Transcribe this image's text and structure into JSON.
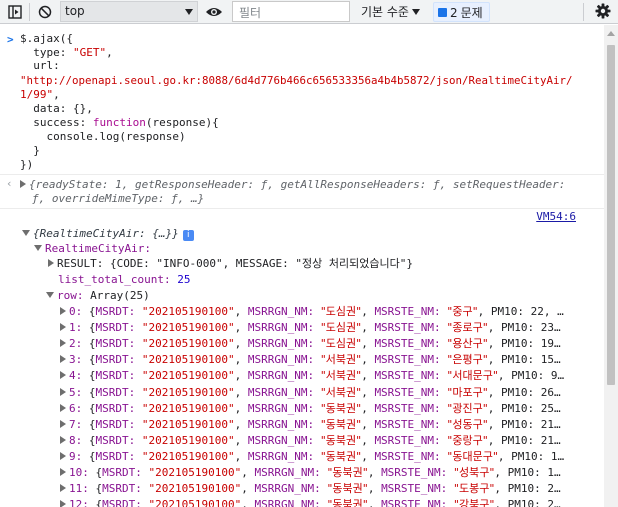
{
  "toolbar": {
    "context": "top",
    "filter_placeholder": "필터",
    "level": "기본 수준",
    "issues_count": "2",
    "issues_label": "문제"
  },
  "input": {
    "lines": [
      "$.ajax({",
      "  type: \"GET\",",
      "  url:",
      "\"http://openapi.seoul.go.kr:8088/6d4d776b466c656533356a4b4b5872/json/RealtimeCityAir/",
      "1/99\",",
      "  data: {},",
      "  success: function(response){",
      "    console.log(response)",
      "  }",
      "})"
    ]
  },
  "return_value": {
    "line1": "{readyState: 1, getResponseHeader: ƒ, getAllResponseHeaders: ƒ, setRequestHeader:",
    "line2": "ƒ, overrideMimeType: ƒ, …}"
  },
  "log": {
    "source": "VM54:6",
    "root": "{RealtimeCityAir: {…}}",
    "info": "i",
    "city_air": "RealtimeCityAir:",
    "result": "RESULT: {CODE: \"INFO-000\", MESSAGE: \"정상 처리되었습니다\"}",
    "list_total_count_key": "list_total_count:",
    "list_total_count": "25",
    "row_key": "row:",
    "row_type": "Array(25)",
    "rows": [
      {
        "i": "0",
        "date": "\"202105190100\"",
        "rgn": "\"도심권\"",
        "ste": "\"중구\"",
        "pm": "PM10: 22, …"
      },
      {
        "i": "1",
        "date": "\"202105190100\"",
        "rgn": "\"도심권\"",
        "ste": "\"종로구\"",
        "pm": "PM10: 23…"
      },
      {
        "i": "2",
        "date": "\"202105190100\"",
        "rgn": "\"도심권\"",
        "ste": "\"용산구\"",
        "pm": "PM10: 19…"
      },
      {
        "i": "3",
        "date": "\"202105190100\"",
        "rgn": "\"서북권\"",
        "ste": "\"은평구\"",
        "pm": "PM10: 15…"
      },
      {
        "i": "4",
        "date": "\"202105190100\"",
        "rgn": "\"서북권\"",
        "ste": "\"서대문구\"",
        "pm": "PM10: 9…"
      },
      {
        "i": "5",
        "date": "\"202105190100\"",
        "rgn": "\"서북권\"",
        "ste": "\"마포구\"",
        "pm": "PM10: 26…"
      },
      {
        "i": "6",
        "date": "\"202105190100\"",
        "rgn": "\"동북권\"",
        "ste": "\"광진구\"",
        "pm": "PM10: 25…"
      },
      {
        "i": "7",
        "date": "\"202105190100\"",
        "rgn": "\"동북권\"",
        "ste": "\"성동구\"",
        "pm": "PM10: 21…"
      },
      {
        "i": "8",
        "date": "\"202105190100\"",
        "rgn": "\"동북권\"",
        "ste": "\"중랑구\"",
        "pm": "PM10: 21…"
      },
      {
        "i": "9",
        "date": "\"202105190100\"",
        "rgn": "\"동북권\"",
        "ste": "\"동대문구\"",
        "pm": "PM10: 1…"
      },
      {
        "i": "10",
        "date": "\"202105190100\"",
        "rgn": "\"동북권\"",
        "ste": "\"성북구\"",
        "pm": "PM10: 1…"
      },
      {
        "i": "11",
        "date": "\"202105190100\"",
        "rgn": "\"동북권\"",
        "ste": "\"도봉구\"",
        "pm": "PM10: 2…"
      },
      {
        "i": "12",
        "date": "\"202105190100\"",
        "rgn": "\"동북권\"",
        "ste": "\"강북구\"",
        "pm": "PM10: 2…"
      }
    ]
  }
}
